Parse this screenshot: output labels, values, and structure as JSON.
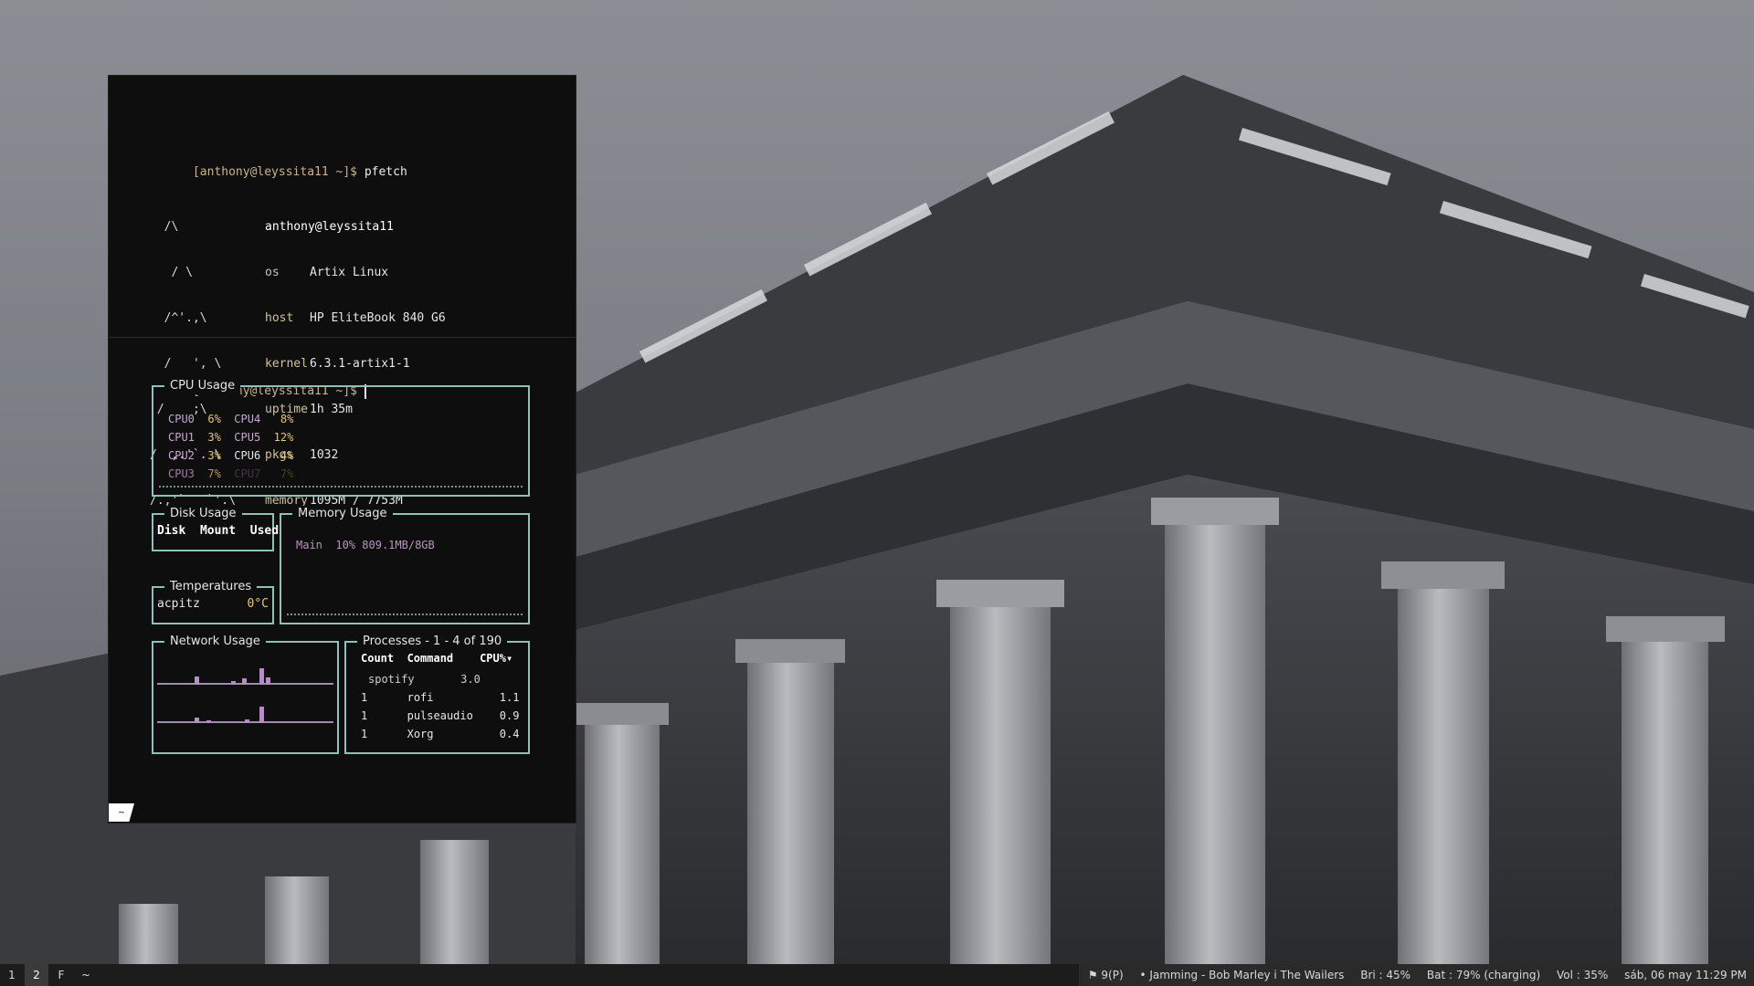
{
  "terminal": {
    "prompt": "[anthony@leyssita11 ~]$",
    "command": "pfetch",
    "pfetch_logo": [
      "  /\\  ",
      "   / \\  ",
      "  /^'.,\\ ",
      "  /   ', \\ ",
      " /    ;\\ ",
      "/  ,.'`. \\",
      "/.,'`   `'.\\"
    ],
    "userhost": "anthony@leyssita11",
    "info": [
      {
        "key": "os",
        "value": "Artix Linux"
      },
      {
        "key": "host",
        "value": "HP EliteBook 840 G6"
      },
      {
        "key": "kernel",
        "value": "6.3.1-artix1-1"
      },
      {
        "key": "uptime",
        "value": "1h 35m"
      },
      {
        "key": "pkgs",
        "value": "1032"
      },
      {
        "key": "memory",
        "value": "1095M / 7753M"
      }
    ],
    "tag": "~"
  },
  "bpytop": {
    "cpu": {
      "title": "CPU Usage",
      "rows": [
        {
          "a_name": "CPU0",
          "a_pct": "6%",
          "b_name": "CPU4",
          "b_pct": "8%"
        },
        {
          "a_name": "CPU1",
          "a_pct": "3%",
          "b_name": "CPU5",
          "b_pct": "12%"
        },
        {
          "a_name": "CPU2",
          "a_pct": "3%",
          "b_name": "CPU6",
          "b_pct": "4%"
        },
        {
          "a_name": "CPU3",
          "a_pct": "7%",
          "b_name": "CPU7",
          "b_pct": "7%"
        }
      ]
    },
    "disk": {
      "title": "Disk Usage",
      "headers": [
        "Disk",
        "Mount",
        "Used"
      ]
    },
    "memory": {
      "title": "Memory Usage",
      "label": "Main",
      "percent": "10%",
      "amount": "809.1MB/8GB"
    },
    "temps": {
      "title": "Temperatures",
      "sensor": "acpitz",
      "value": "0°C"
    },
    "network": {
      "title": "Network Usage"
    },
    "processes": {
      "title": "Processes - 1 - 4 of 190",
      "headers": [
        "Count",
        "Command",
        "CPU%▾"
      ],
      "rows": [
        {
          "count": "",
          "command": "spotify",
          "cpu": "3.0"
        },
        {
          "count": "1",
          "command": "rofi",
          "cpu": "1.1"
        },
        {
          "count": "1",
          "command": "pulseaudio",
          "cpu": "0.9"
        },
        {
          "count": "1",
          "command": "Xorg",
          "cpu": "0.4"
        }
      ]
    }
  },
  "bar": {
    "workspaces": [
      "1",
      "2",
      "F",
      "~"
    ],
    "active_workspace": "2",
    "status": {
      "updates": "⚑ 9(P)",
      "music": "• Jamming - Bob Marley i The Wailers",
      "brightness": "Bri : 45%",
      "battery": "Bat : 79% (charging)",
      "volume": "Vol : 35%",
      "datetime": "sáb, 06 may 11:29 PM"
    }
  }
}
